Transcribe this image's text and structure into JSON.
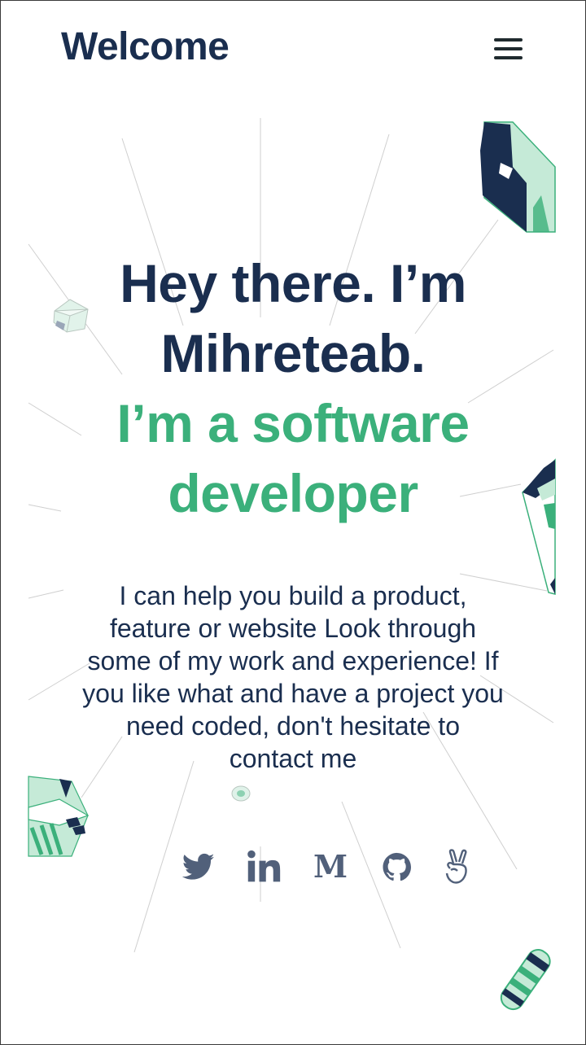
{
  "header": {
    "title": "Welcome",
    "menu_icon": "hamburger-menu-icon"
  },
  "hero": {
    "headline_line1": "Hey there. I’m",
    "headline_line2": "Mihreteab.",
    "subheadline_line1": "I’m a software",
    "subheadline_line2": "developer",
    "intro": "I can help you build a product, feature or website Look through some of my work and experience! If you like what and have a project you need coded, don't hesitate to contact me"
  },
  "socials": [
    {
      "name": "Twitter",
      "icon": "twitter-icon"
    },
    {
      "name": "LinkedIn",
      "icon": "linkedin-icon"
    },
    {
      "name": "Medium",
      "icon": "medium-icon"
    },
    {
      "name": "GitHub",
      "icon": "github-icon"
    },
    {
      "name": "AngelList",
      "icon": "angellist-icon"
    }
  ],
  "colors": {
    "primary": "#1a2e4f",
    "accent": "#3bb07b",
    "icon": "#51607a",
    "mint": "#c5ead7",
    "background": "#ffffff"
  }
}
